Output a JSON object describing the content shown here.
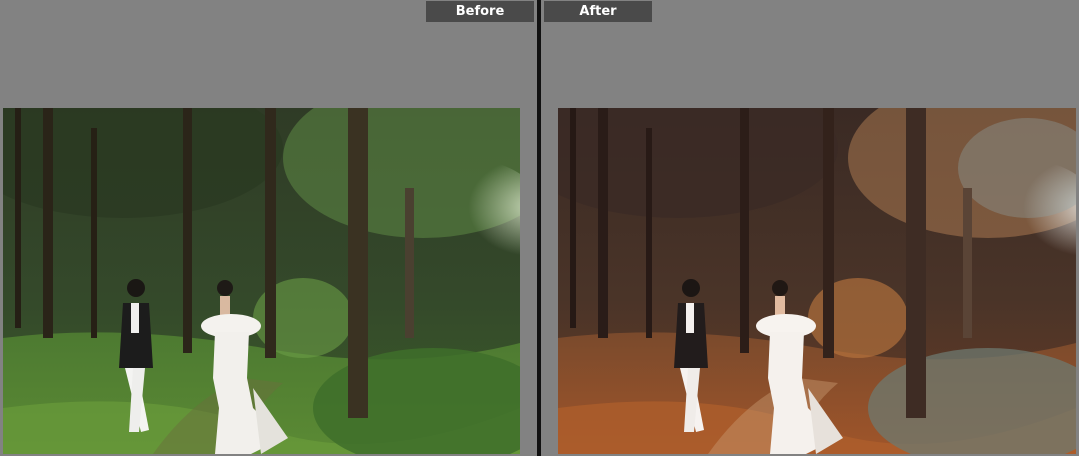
{
  "labels": {
    "before": "Before",
    "after": "After"
  },
  "colors": {
    "background": "#828282",
    "label_bg": "#4a4a4a",
    "divider": "#111111",
    "before_foliage": "#3f6b2c",
    "after_foliage": "#8a4a2e"
  }
}
